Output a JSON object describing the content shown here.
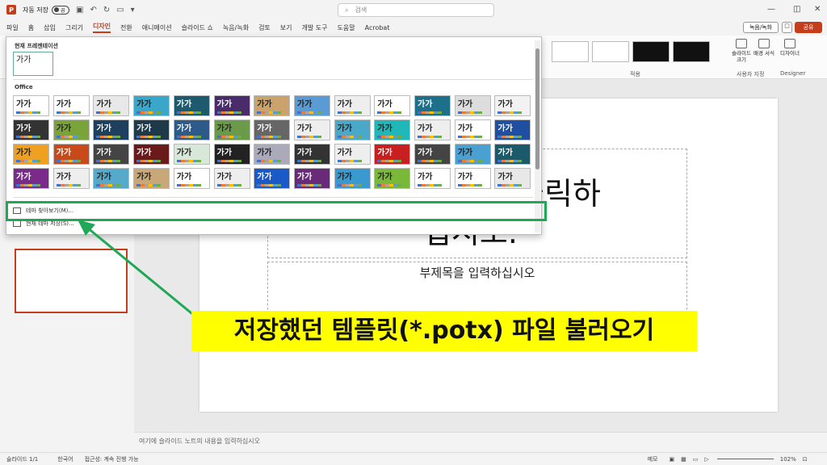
{
  "titlebar": {
    "autosave_label": "자동 저장",
    "toggle_state": "끔",
    "search_placeholder": "검색"
  },
  "menu": [
    "파일",
    "홈",
    "삽입",
    "그리기",
    "디자인",
    "전환",
    "애니메이션",
    "슬라이드 쇼",
    "녹음/녹화",
    "검토",
    "보기",
    "개발 도구",
    "도움말",
    "Acrobat"
  ],
  "menu_active_index": 4,
  "header_buttons": {
    "record": "녹음/녹화",
    "share": "공유"
  },
  "ribbon": {
    "variants_label": "적용",
    "slide_size": "슬라이드 크기",
    "format_background": "배경 서식",
    "customize_label": "사용자 지정",
    "designer": "디자이너",
    "designer_group": "Designer"
  },
  "gallery": {
    "current_section": "현재 프레젠테이션",
    "office_section": "Office",
    "tile_text": "가가",
    "browse_themes": "테마 찾아보기(M)...",
    "save_theme": "현재 테마 저장(S)..."
  },
  "slide": {
    "title_text_line1": "면 클릭하",
    "title_text_line2": "십시오.",
    "subtitle_text": "부제목을 입력하십시오"
  },
  "notes_placeholder": "여기에 슬라이드 노트의 내용을 입력하십시오",
  "status": {
    "slide_count": "슬라이드 1/1",
    "language": "한국어",
    "accessibility": "접근성: 계속 진행 가능",
    "notes_btn": "메모",
    "zoom": "102%"
  },
  "callout_text": "저장했던 템플릿(*.potx) 파일 불러오기",
  "colors": {
    "accent": "#c43e1c",
    "highlight": "#1fa855",
    "callout_bg": "#ffff00"
  }
}
